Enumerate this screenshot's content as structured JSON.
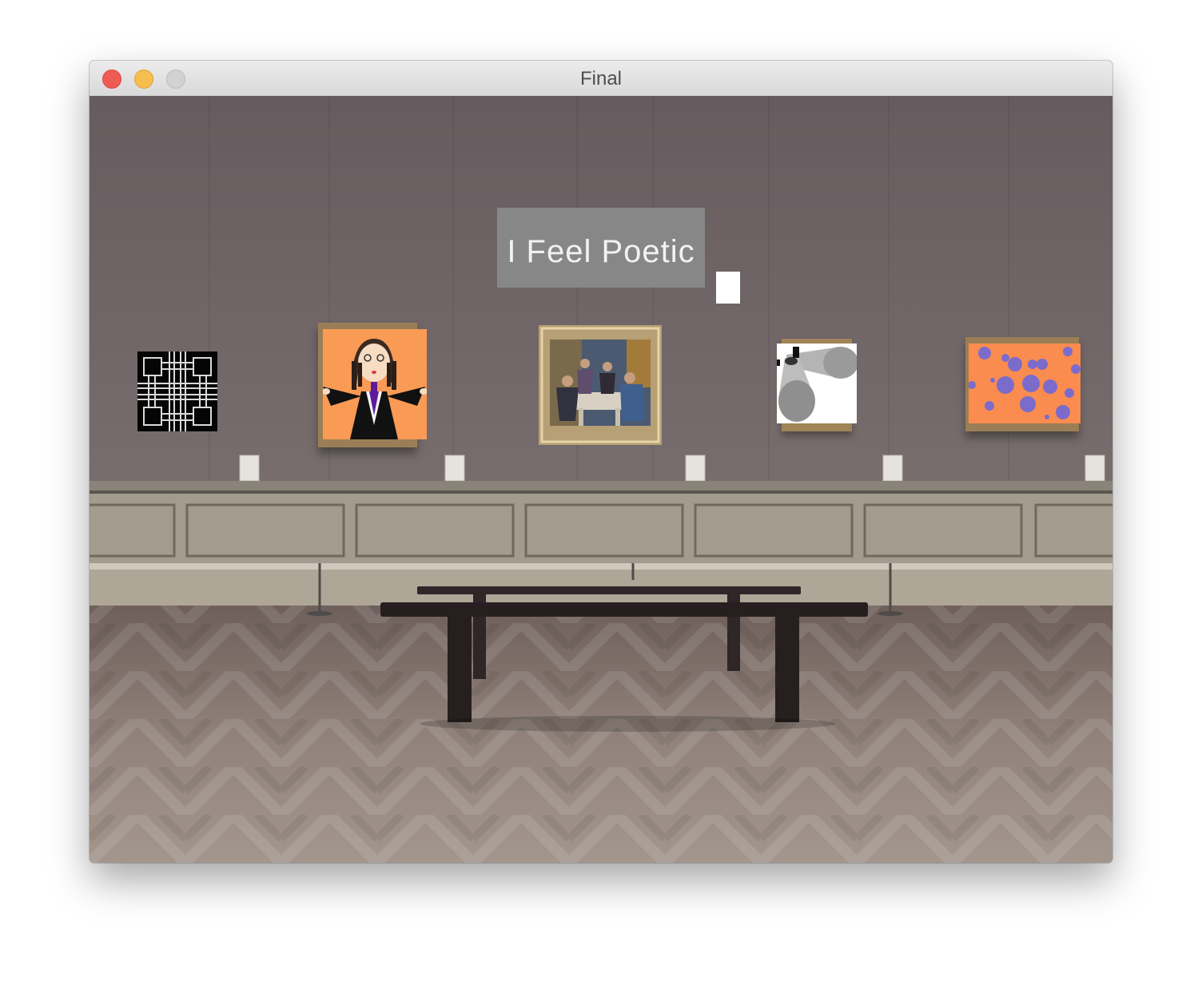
{
  "window": {
    "title": "Final"
  },
  "traffic_lights": {
    "close": "close-button",
    "minimize": "minimize-button",
    "zoom": "zoom-button"
  },
  "colors": {
    "wall": "#6f6567",
    "wainscot": "#9c9486",
    "floor": "#8a7b72",
    "title_box": "#878787",
    "orange": "#fa9a55",
    "dot_purple": "#7a69c9"
  },
  "gallery": {
    "title_text": "I Feel Poetic"
  }
}
